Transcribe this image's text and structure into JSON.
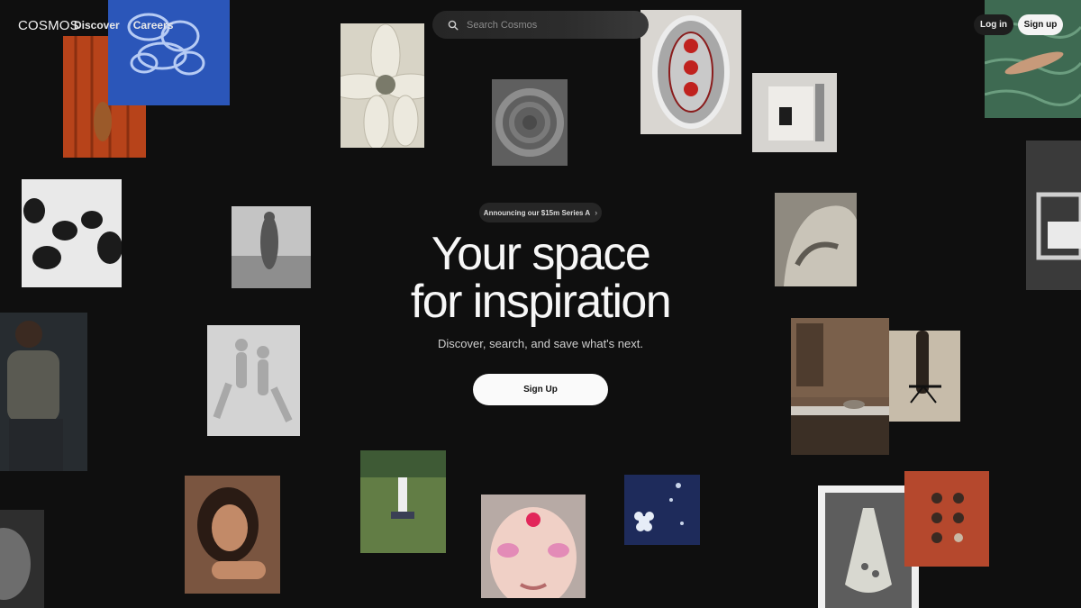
{
  "header": {
    "logo": "COSMOS",
    "nav": [
      "Discover",
      "Careers"
    ],
    "search_placeholder": "Search Cosmos",
    "login_label": "Log in",
    "signup_label": "Sign up"
  },
  "hero": {
    "announcement": "Announcing our $15m Series A",
    "announcement_chevron": "›",
    "headline_line1": "Your space",
    "headline_line2": "for inspiration",
    "subheadline": "Discover, search, and save what's next.",
    "cta_label": "Sign Up"
  },
  "colors": {
    "background": "#0f0f0f",
    "primary_button": "#fafafa",
    "pill": "#262626"
  }
}
